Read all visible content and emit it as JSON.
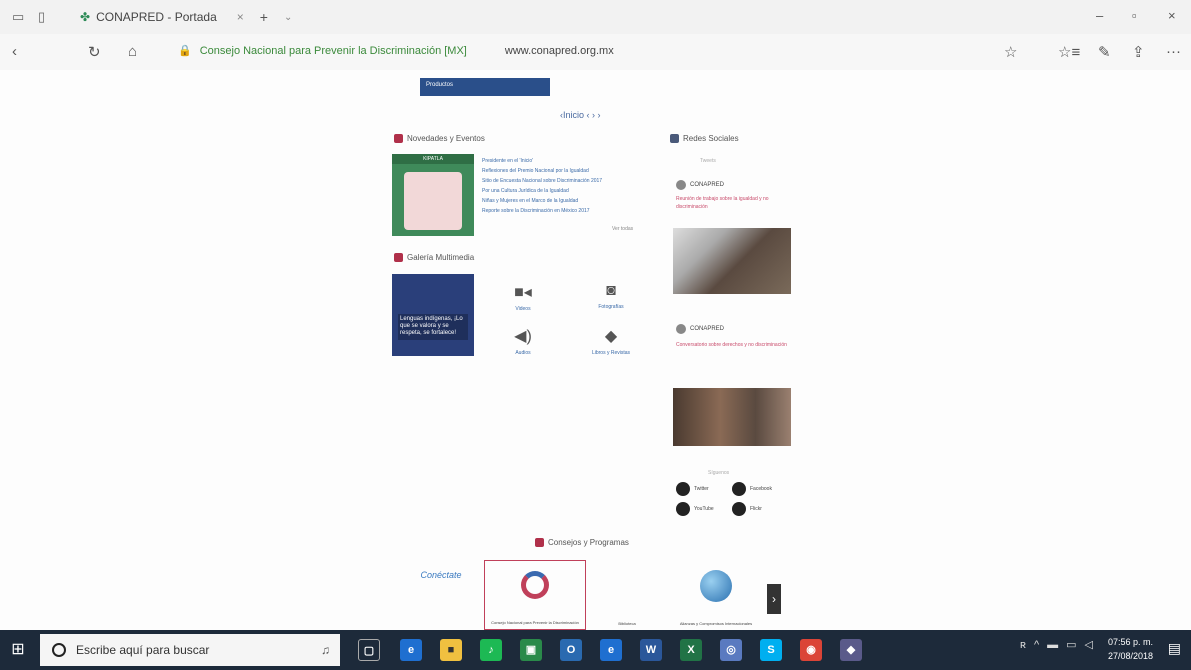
{
  "browser": {
    "tab_title": "CONAPRED - Portada",
    "tab_close": "×",
    "new_tab": "+",
    "tab_menu": "⌄",
    "site_title": "Consejo Nacional para Prevenir la Discriminación [MX]",
    "url": "www.conapred.org.mx",
    "back": "‹",
    "refresh": "↻",
    "home": "⌂",
    "win_min": "–",
    "win_max": "▫",
    "win_close": "×",
    "favorite": "☆",
    "favorites": "☆≡",
    "notes": "✎",
    "share": "⇪",
    "more": "···"
  },
  "page": {
    "products_label": "Productos",
    "pager": "‹Inicio ‹ › ›",
    "novedades_title": "Novedades y Eventos",
    "novedades_img_title": "KIPATLA",
    "novedades_items": [
      "Presidente en el 'Inicio'",
      "Reflexiones del Premio Nacional por la Igualdad",
      "Sitio de Encuesta Nacional sobre Discriminación 2017",
      "Por una Cultura Jurídica de la Igualdad",
      "Niñas y Mujeres en el Marco de la Igualdad",
      "Reporte sobre la Discriminación en México 2017"
    ],
    "ver_todas": "Ver todas",
    "galeria_title": "Galería Multimedia",
    "galeria_caption": "Lenguas indígenas, ¡Lo que se valora y se respeta, se fortalece!",
    "media_items": [
      "Videos",
      "Fotografías",
      "Audios",
      "Libros y Revistas"
    ],
    "redes_title": "Redes Sociales",
    "redes_sub": "Tweets",
    "tweet1_author": "CONAPRED",
    "tweet1_text": "Reunión de trabajo sobre la igualdad y no discriminación",
    "tweet2_author": "CONAPRED",
    "tweet2_text": "Conversatorio sobre derechos y no discriminación",
    "siguenos": "Síguenos",
    "social": [
      "Twitter",
      "Facebook",
      "YouTube",
      "Flickr"
    ],
    "consejos_title": "Consejos y Programas",
    "logos": [
      "Conéctate",
      "Consejo Nacional para Prevenir la Discriminación",
      "Biblioteca",
      "Alianzas y Compromisos Internacionales"
    ],
    "next": "›"
  },
  "taskbar": {
    "start": "⊞",
    "search_placeholder": "Escribe aquí para buscar",
    "mic": "♫",
    "time": "07:56 p. m.",
    "date": "27/08/2018",
    "notif": "▤",
    "task_labels": [
      "▢",
      "e",
      "■",
      "♪",
      "▣",
      "O",
      "e",
      "W",
      "X",
      "◎",
      "S",
      "◉",
      "◆"
    ],
    "tray": [
      "ʀ",
      "^",
      "▬",
      "▭",
      "◁"
    ]
  }
}
